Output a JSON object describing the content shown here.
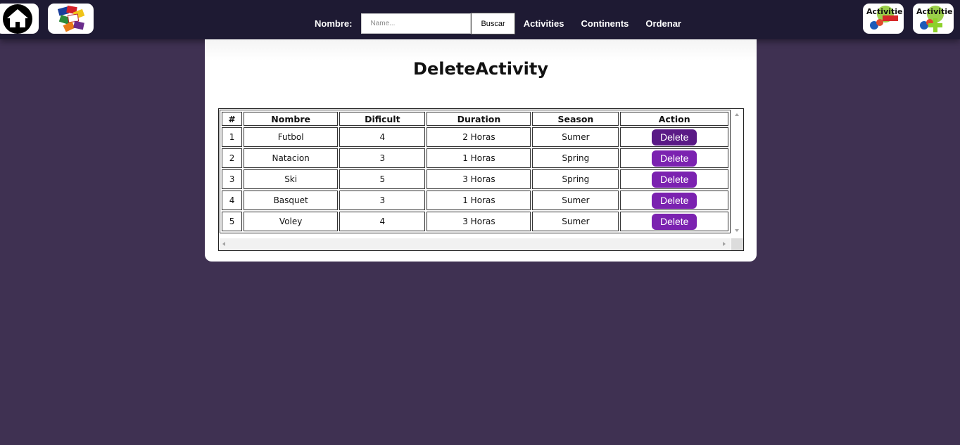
{
  "header": {
    "search_label": "Nombre:",
    "search_placeholder": "Name...",
    "search_value": "",
    "search_button": "Buscar",
    "links": [
      "Activities",
      "Continents",
      "Ordenar"
    ],
    "left_icons": [
      "home-icon",
      "flags-icon"
    ],
    "right_icons": [
      {
        "name": "activity-icon",
        "label": "Activitie"
      },
      {
        "name": "activity-add-icon",
        "label": "Activitie"
      }
    ]
  },
  "page": {
    "title": "DeleteActivity"
  },
  "table": {
    "columns": [
      "#",
      "Nombre",
      "Dificult",
      "Duration",
      "Season",
      "Action"
    ],
    "rows": [
      {
        "id": "1",
        "name": "Futbol",
        "difficulty": "4",
        "duration": "2 Horas",
        "season": "Sumer",
        "action": "Delete"
      },
      {
        "id": "2",
        "name": "Natacion",
        "difficulty": "3",
        "duration": "1 Horas",
        "season": "Spring",
        "action": "Delete"
      },
      {
        "id": "3",
        "name": "Ski",
        "difficulty": "5",
        "duration": "3 Horas",
        "season": "Spring",
        "action": "Delete"
      },
      {
        "id": "4",
        "name": "Basquet",
        "difficulty": "3",
        "duration": "1 Horas",
        "season": "Sumer",
        "action": "Delete"
      },
      {
        "id": "5",
        "name": "Voley",
        "difficulty": "4",
        "duration": "3 Horas",
        "season": "Sumer",
        "action": "Delete"
      }
    ]
  },
  "colors": {
    "background": "#3f3152",
    "topbar": "#1e1a33",
    "delete_button": "#7b22b0",
    "delete_button_active": "#5a1a86"
  }
}
